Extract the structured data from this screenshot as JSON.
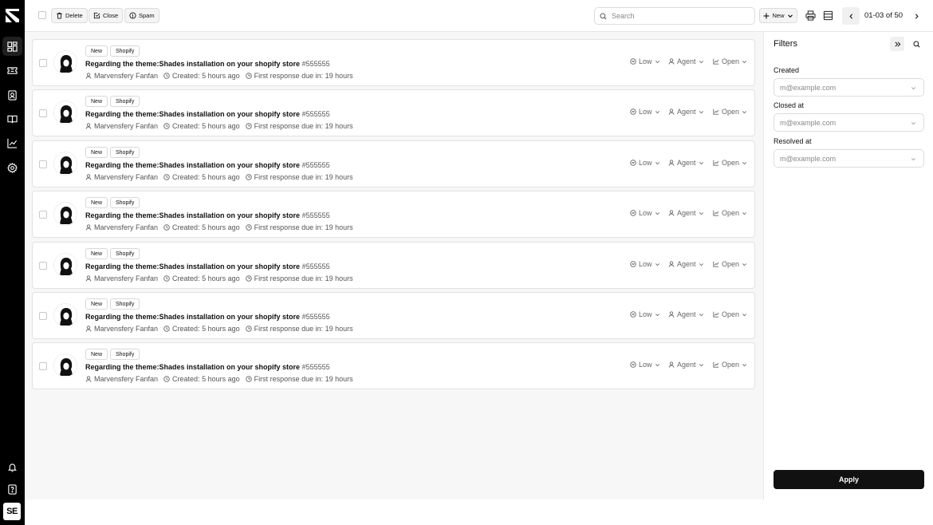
{
  "toolbar": {
    "delete_label": "Delete",
    "close_label": "Close",
    "spam_label": "Spam",
    "search_placeholder": "Search",
    "new_label": "New",
    "page_info": "01-03 of 50"
  },
  "sidebar": {
    "items": [
      {
        "icon": "dashboard-icon",
        "active": true
      },
      {
        "icon": "ticket-icon",
        "active": false
      },
      {
        "icon": "contacts-icon",
        "active": false
      },
      {
        "icon": "knowledge-base-icon",
        "active": false
      },
      {
        "icon": "analytics-icon",
        "active": false
      },
      {
        "icon": "settings-icon",
        "active": false
      }
    ],
    "bottom": [
      "notification-bell-icon",
      "help-icon"
    ],
    "avatar_initials": "SE"
  },
  "tickets": [
    {
      "tags": [
        "New",
        "Shopify"
      ],
      "title": "Regarding the theme:Shades installation on your shopify store",
      "number": "#555555",
      "customer": "Marvensfery Fanfan",
      "created": "Created: 5 hours ago",
      "due": "First response due in: 19 hours",
      "priority": "Low",
      "assignee": "Agent",
      "status": "Open"
    },
    {
      "tags": [
        "New",
        "Shopify"
      ],
      "title": "Regarding the theme:Shades installation on your shopify store",
      "number": "#555555",
      "customer": "Marvensfery Fanfan",
      "created": "Created: 5 hours ago",
      "due": "First response due in: 19 hours",
      "priority": "Low",
      "assignee": "Agent",
      "status": "Open"
    },
    {
      "tags": [
        "New",
        "Shopify"
      ],
      "title": "Regarding the theme:Shades installation on your shopify store",
      "number": "#555555",
      "customer": "Marvensfery Fanfan",
      "created": "Created: 5 hours ago",
      "due": "First response due in: 19 hours",
      "priority": "Low",
      "assignee": "Agent",
      "status": "Open"
    },
    {
      "tags": [
        "New",
        "Shopify"
      ],
      "title": "Regarding the theme:Shades installation on your shopify store",
      "number": "#555555",
      "customer": "Marvensfery Fanfan",
      "created": "Created: 5 hours ago",
      "due": "First response due in: 19 hours",
      "priority": "Low",
      "assignee": "Agent",
      "status": "Open"
    },
    {
      "tags": [
        "New",
        "Shopify"
      ],
      "title": "Regarding the theme:Shades installation on your shopify store",
      "number": "#555555",
      "customer": "Marvensfery Fanfan",
      "created": "Created: 5 hours ago",
      "due": "First response due in: 19 hours",
      "priority": "Low",
      "assignee": "Agent",
      "status": "Open"
    },
    {
      "tags": [
        "New",
        "Shopify"
      ],
      "title": "Regarding the theme:Shades installation on your shopify store",
      "number": "#555555",
      "customer": "Marvensfery Fanfan",
      "created": "Created: 5 hours ago",
      "due": "First response due in: 19 hours",
      "priority": "Low",
      "assignee": "Agent",
      "status": "Open"
    },
    {
      "tags": [
        "New",
        "Shopify"
      ],
      "title": "Regarding the theme:Shades installation on your shopify store",
      "number": "#555555",
      "customer": "Marvensfery Fanfan",
      "created": "Created: 5 hours ago",
      "due": "First response due in: 19 hours",
      "priority": "Low",
      "assignee": "Agent",
      "status": "Open"
    }
  ],
  "filters": {
    "title": "Filters",
    "fields": [
      {
        "label": "Created",
        "value": "m@example.com"
      },
      {
        "label": "Closed at",
        "value": "m@example.com"
      },
      {
        "label": "Resolved at",
        "value": "m@example.com"
      }
    ],
    "apply_label": "Apply"
  }
}
